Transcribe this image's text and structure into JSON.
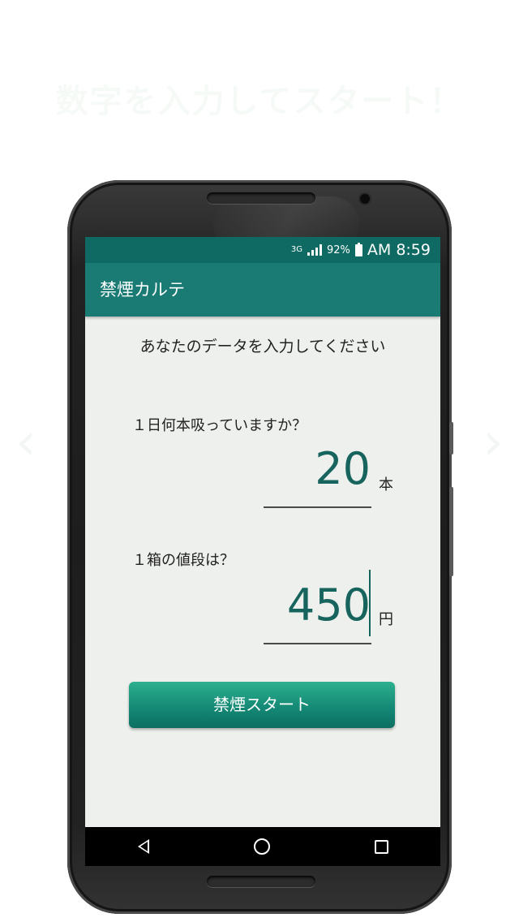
{
  "headline": "数字を入力してスタート！",
  "status_bar": {
    "network": "3G",
    "battery_percent": "92%",
    "time": "AM 8:59"
  },
  "app_bar": {
    "title": "禁煙カルテ"
  },
  "form": {
    "prompt": "あなたのデータを入力してください",
    "cigarettes_question": "１日何本吸っていますか？",
    "cigarettes_value": "20",
    "cigarettes_unit": "本",
    "price_question": "１箱の値段は？",
    "price_value": "450",
    "price_unit": "円"
  },
  "start_button": {
    "label": "禁煙スタート"
  },
  "colors": {
    "primary_dark": "#0f6a64",
    "primary": "#1a7a74",
    "accent_number": "#17635d",
    "button": "#158a76"
  },
  "icons": [
    "chevron-left-icon",
    "chevron-right-icon",
    "signal-icon",
    "battery-icon",
    "back-icon",
    "home-icon",
    "recents-icon"
  ]
}
